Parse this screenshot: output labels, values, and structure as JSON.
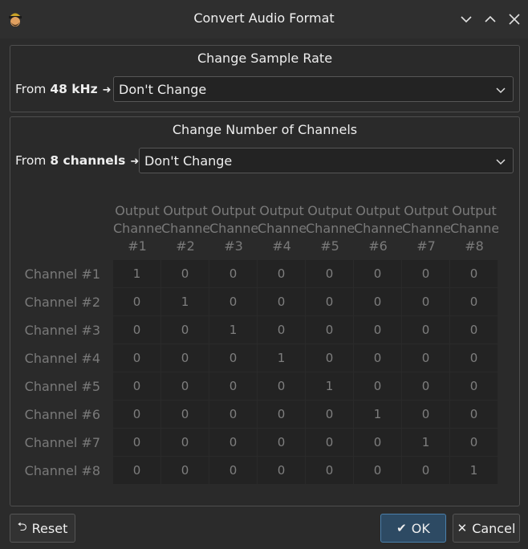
{
  "window": {
    "title": "Convert Audio Format",
    "icons": [
      "app-icon",
      "minimize-icon",
      "maximize-icon",
      "close-icon"
    ]
  },
  "sample_rate": {
    "title": "Change Sample Rate",
    "from_prefix": "From",
    "from_value": "48 kHz",
    "selected": "Don't Change"
  },
  "channels": {
    "title": "Change Number of Channels",
    "from_prefix": "From",
    "from_value": "8 channels",
    "selected": "Don't Change",
    "output_headers": [
      [
        "Output",
        "Channel",
        "#1"
      ],
      [
        "Output",
        "Channel",
        "#2"
      ],
      [
        "Output",
        "Channel",
        "#3"
      ],
      [
        "Output",
        "Channel",
        "#4"
      ],
      [
        "Output",
        "Channel",
        "#5"
      ],
      [
        "Output",
        "Channel",
        "#6"
      ],
      [
        "Output",
        "Channel",
        "#7"
      ],
      [
        "Output",
        "Channel",
        "#8"
      ]
    ],
    "rows": [
      {
        "label": "Channel #1",
        "values": [
          "1",
          "0",
          "0",
          "0",
          "0",
          "0",
          "0",
          "0"
        ]
      },
      {
        "label": "Channel #2",
        "values": [
          "0",
          "1",
          "0",
          "0",
          "0",
          "0",
          "0",
          "0"
        ]
      },
      {
        "label": "Channel #3",
        "values": [
          "0",
          "0",
          "1",
          "0",
          "0",
          "0",
          "0",
          "0"
        ]
      },
      {
        "label": "Channel #4",
        "values": [
          "0",
          "0",
          "0",
          "1",
          "0",
          "0",
          "0",
          "0"
        ]
      },
      {
        "label": "Channel #5",
        "values": [
          "0",
          "0",
          "0",
          "0",
          "1",
          "0",
          "0",
          "0"
        ]
      },
      {
        "label": "Channel #6",
        "values": [
          "0",
          "0",
          "0",
          "0",
          "0",
          "1",
          "0",
          "0"
        ]
      },
      {
        "label": "Channel #7",
        "values": [
          "0",
          "0",
          "0",
          "0",
          "0",
          "0",
          "1",
          "0"
        ]
      },
      {
        "label": "Channel #8",
        "values": [
          "0",
          "0",
          "0",
          "0",
          "0",
          "0",
          "0",
          "1"
        ]
      }
    ]
  },
  "buttons": {
    "reset": "Reset",
    "ok": "OK",
    "cancel": "Cancel"
  },
  "colors": {
    "ok_accent": "#2d4a63"
  }
}
